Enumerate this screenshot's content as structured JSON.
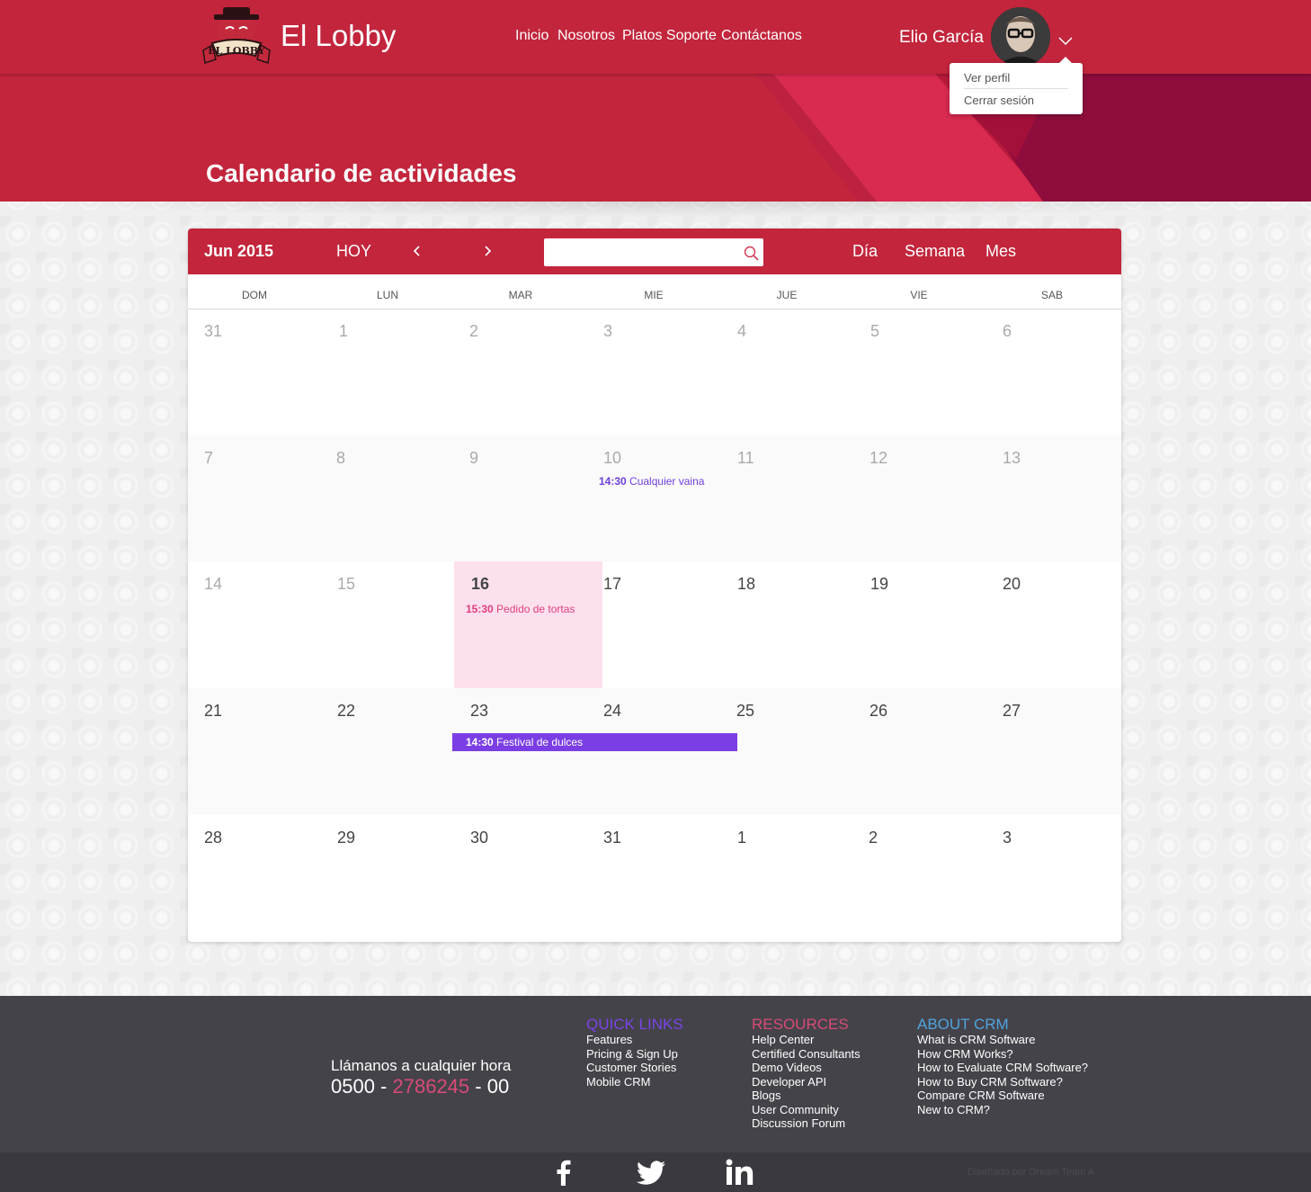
{
  "header": {
    "brand": "El Lobby",
    "logo_text": "EL LOBBY",
    "nav": [
      "Inicio",
      "Nosotros",
      "Platos Soporte",
      "Contáctanos"
    ],
    "user_name": "Elio García",
    "dropdown": [
      "Ver perfil",
      "Cerrar sesión"
    ]
  },
  "banner": {
    "title": "Calendario de actividades"
  },
  "calendar": {
    "month_label": "Jun 2015",
    "today_label": "HOY",
    "search": {
      "value": "",
      "placeholder": ""
    },
    "views": [
      "Día",
      "Semana",
      "Mes"
    ],
    "day_headers": [
      "DOM",
      "LUN",
      "MAR",
      "MIE",
      "JUE",
      "VIE",
      "SAB"
    ],
    "weeks": [
      [
        "31",
        "1",
        "2",
        "3",
        "4",
        "5",
        "6"
      ],
      [
        "7",
        "8",
        "9",
        "10",
        "11",
        "12",
        "13"
      ],
      [
        "14",
        "15",
        "16",
        "17",
        "18",
        "19",
        "20"
      ],
      [
        "21",
        "22",
        "23",
        "24",
        "25",
        "26",
        "27"
      ],
      [
        "28",
        "29",
        "30",
        "31",
        "1",
        "2",
        "3"
      ]
    ],
    "today_date": "16",
    "events": [
      {
        "time": "14:30",
        "title": "Cualquier vaina",
        "color": "#6e3fdc"
      },
      {
        "time": "15:30",
        "title": "Pedido de tortas",
        "color": "#e0407e"
      },
      {
        "time": "14:30",
        "title": "Festival de dulces",
        "color": "#7a3ee4"
      }
    ]
  },
  "footer": {
    "call_label": "Llámanos a cualquier hora",
    "phone": {
      "prefix": "0500 - ",
      "main": "2786245",
      "suffix": " - 00"
    },
    "columns": [
      {
        "title": "QUICK LINKS",
        "color": "#7a44e6",
        "links": [
          "Features",
          "Pricing & Sign Up",
          "Customer Stories",
          "Mobile CRM"
        ]
      },
      {
        "title": "RESOURCES",
        "color": "#d94a78",
        "links": [
          "Help Center",
          "Certified Consultants",
          "Demo Videos",
          "Developer API",
          "Blogs",
          "User Community",
          "Discussion Forum"
        ]
      },
      {
        "title": "ABOUT CRM",
        "color": "#4fa3df",
        "links": [
          "What is CRM Software",
          "How CRM Works?",
          "How to Evaluate CRM Software?",
          "How to Buy CRM Software?",
          "Compare CRM Software",
          "New to CRM?"
        ]
      }
    ],
    "social": [
      "facebook-icon",
      "twitter-icon",
      "linkedin-icon"
    ],
    "credit": "Diseñado por Dream Team A"
  },
  "colors": {
    "primary": "#c2253c",
    "today_bg": "#fde0ed",
    "event_purple": "#7a3ee4",
    "footer_bg": "#444349"
  }
}
